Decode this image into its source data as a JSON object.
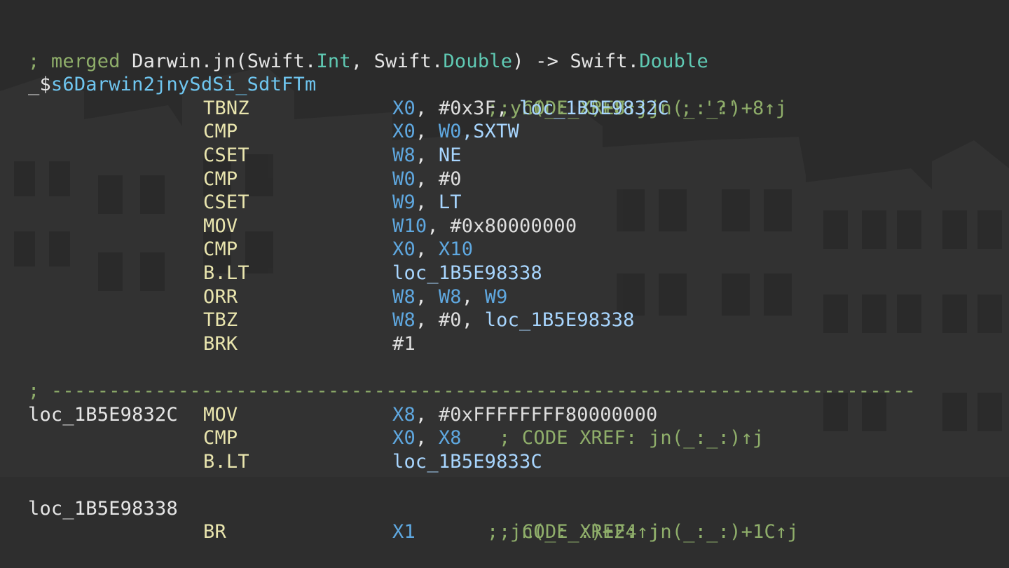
{
  "colors": {
    "background": "#2b2b2b",
    "plain_text": "#e6e6e6",
    "mnemonic": "#e9e5ae",
    "comment": "#8fae6a",
    "type_name": "#5fc9b3",
    "symbol_label": "#6fc6f0",
    "register": "#5fa8e0",
    "operand": "#a8d6ff"
  },
  "header": {
    "comment_prefix": "; merged ",
    "func_module": "Darwin.",
    "func_name": "jn",
    "paren_open": "(Swift.",
    "arg1_type": "Int",
    "sep": ", Swift.",
    "arg2_type": "Double",
    "arrow": ") -> Swift.",
    "return_type": "Double",
    "symbol_prefix": "_$",
    "symbol_name": "s6Darwin2jnySdSi_SdtFTm",
    "xref1": "; CODE XREF: jn(_:_:)+8↑j",
    "xref2": "; yn(_:_:)+8↑j"
  },
  "block1": [
    {
      "mnemonic": "TBNZ",
      "ops": [
        {
          "t": "X0",
          "k": "reg"
        },
        {
          "t": ", ",
          "k": "plain"
        },
        {
          "t": "#0x3F",
          "k": "num"
        },
        {
          "t": ", ",
          "k": "plain"
        },
        {
          "t": "loc_1B5E9832C",
          "k": "operand"
        },
        {
          "t": " ; '?'",
          "k": "comment"
        }
      ]
    },
    {
      "mnemonic": "CMP",
      "ops": [
        {
          "t": "X0",
          "k": "reg"
        },
        {
          "t": ", ",
          "k": "plain"
        },
        {
          "t": "W0",
          "k": "reg"
        },
        {
          "t": ",SXTW",
          "k": "operand"
        }
      ]
    },
    {
      "mnemonic": "CSET",
      "ops": [
        {
          "t": "W8",
          "k": "reg"
        },
        {
          "t": ", ",
          "k": "plain"
        },
        {
          "t": "NE",
          "k": "operand"
        }
      ]
    },
    {
      "mnemonic": "CMP",
      "ops": [
        {
          "t": "W0",
          "k": "reg"
        },
        {
          "t": ", ",
          "k": "plain"
        },
        {
          "t": "#0",
          "k": "num"
        }
      ]
    },
    {
      "mnemonic": "CSET",
      "ops": [
        {
          "t": "W9",
          "k": "reg"
        },
        {
          "t": ", ",
          "k": "plain"
        },
        {
          "t": "LT",
          "k": "operand"
        }
      ]
    },
    {
      "mnemonic": "MOV",
      "ops": [
        {
          "t": "W10",
          "k": "reg"
        },
        {
          "t": ", ",
          "k": "plain"
        },
        {
          "t": "#0x80000000",
          "k": "num"
        }
      ]
    },
    {
      "mnemonic": "CMP",
      "ops": [
        {
          "t": "X0",
          "k": "reg"
        },
        {
          "t": ", ",
          "k": "plain"
        },
        {
          "t": "X10",
          "k": "reg"
        }
      ]
    },
    {
      "mnemonic": "B.LT",
      "ops": [
        {
          "t": "loc_1B5E98338",
          "k": "operand"
        }
      ]
    },
    {
      "mnemonic": "ORR",
      "ops": [
        {
          "t": "W8",
          "k": "reg"
        },
        {
          "t": ", ",
          "k": "plain"
        },
        {
          "t": "W8",
          "k": "reg"
        },
        {
          "t": ", ",
          "k": "plain"
        },
        {
          "t": "W9",
          "k": "reg"
        }
      ]
    },
    {
      "mnemonic": "TBZ",
      "ops": [
        {
          "t": "W8",
          "k": "reg"
        },
        {
          "t": ", ",
          "k": "plain"
        },
        {
          "t": "#0",
          "k": "num"
        },
        {
          "t": ", ",
          "k": "plain"
        },
        {
          "t": "loc_1B5E98338",
          "k": "operand"
        }
      ]
    },
    {
      "mnemonic": "BRK",
      "ops": [
        {
          "t": "#1",
          "k": "num"
        }
      ]
    }
  ],
  "separator": "; ---------------------------------------------------------------------------",
  "label1": {
    "name": "loc_1B5E9832C",
    "xref": "; CODE XREF: jn(_:_:)↑j"
  },
  "block2": [
    {
      "mnemonic": "MOV",
      "ops": [
        {
          "t": "X8",
          "k": "reg"
        },
        {
          "t": ", ",
          "k": "plain"
        },
        {
          "t": "#0xFFFFFFFF80000000",
          "k": "num"
        }
      ]
    },
    {
      "mnemonic": "CMP",
      "ops": [
        {
          "t": "X0",
          "k": "reg"
        },
        {
          "t": ", ",
          "k": "plain"
        },
        {
          "t": "X8",
          "k": "reg"
        }
      ]
    },
    {
      "mnemonic": "B.LT",
      "ops": [
        {
          "t": "loc_1B5E9833C",
          "k": "operand"
        }
      ]
    }
  ],
  "label2": {
    "name": "loc_1B5E98338",
    "xref1": "; CODE XREF: jn(_:_:)+1C↑j",
    "xref2": "; jn(_:_:)+24↑j"
  },
  "block3": [
    {
      "mnemonic": "BR",
      "ops": [
        {
          "t": "X1",
          "k": "reg"
        }
      ]
    }
  ]
}
